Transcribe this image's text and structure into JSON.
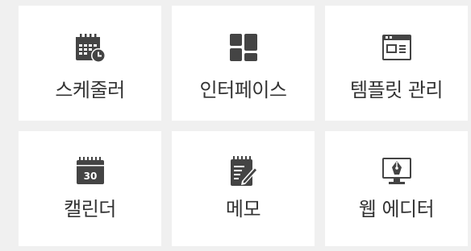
{
  "colors": {
    "page_background": "#f0f0f0",
    "tile_background": "#ffffff",
    "icon": "#444444",
    "label": "#333333"
  },
  "tiles": [
    {
      "label": "스케줄러",
      "icon": "calendar-clock-icon"
    },
    {
      "label": "인터페이스",
      "icon": "layout-grid-icon"
    },
    {
      "label": "템플릿 관리",
      "icon": "template-window-icon"
    },
    {
      "label": "캘린더",
      "icon": "calendar-30-icon",
      "icon_text": "30"
    },
    {
      "label": "메모",
      "icon": "memo-pencil-icon"
    },
    {
      "label": "웹 에디터",
      "icon": "monitor-pen-icon"
    }
  ]
}
